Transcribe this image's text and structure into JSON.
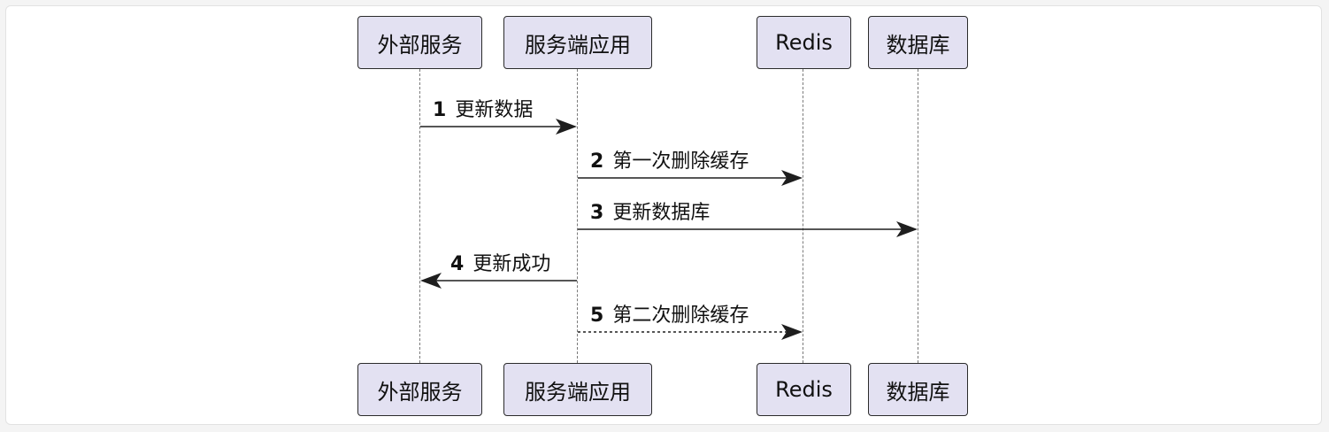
{
  "participants": [
    {
      "id": "external",
      "label": "外部服务"
    },
    {
      "id": "server",
      "label": "服务端应用"
    },
    {
      "id": "redis",
      "label": "Redis"
    },
    {
      "id": "db",
      "label": "数据库"
    }
  ],
  "messages": [
    {
      "num": "1",
      "text": "更新数据",
      "from": "external",
      "to": "server",
      "style": "solid"
    },
    {
      "num": "2",
      "text": "第一次删除缓存",
      "from": "server",
      "to": "redis",
      "style": "solid"
    },
    {
      "num": "3",
      "text": "更新数据库",
      "from": "server",
      "to": "db",
      "style": "solid"
    },
    {
      "num": "4",
      "text": "更新成功",
      "from": "server",
      "to": "external",
      "style": "solid"
    },
    {
      "num": "5",
      "text": "第二次删除缓存",
      "from": "server",
      "to": "redis",
      "style": "dashed"
    }
  ]
}
